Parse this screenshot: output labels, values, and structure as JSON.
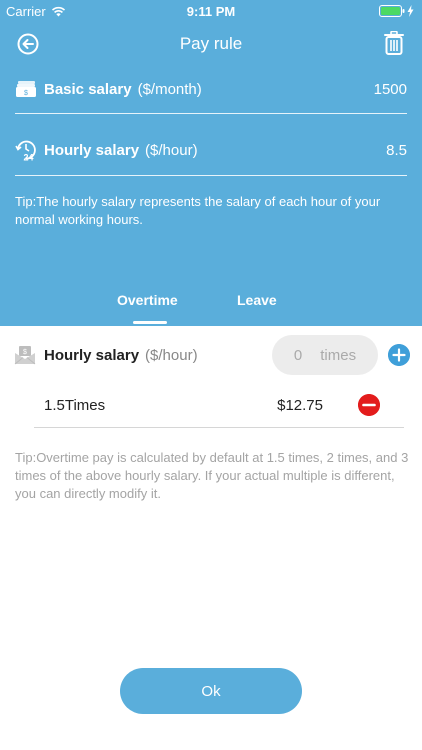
{
  "status": {
    "carrier": "Carrier",
    "time": "9:11 PM"
  },
  "nav": {
    "title": "Pay rule"
  },
  "basic": {
    "label": "Basic salary",
    "unit": "($/month)",
    "value": "1500"
  },
  "hourly": {
    "label": "Hourly salary",
    "unit": "($/hour)",
    "value": "8.5"
  },
  "tip_top": "Tip:The hourly salary represents the salary of each hour of your normal working hours.",
  "tabs": [
    {
      "label": "Overtime",
      "active": true
    },
    {
      "label": "Leave",
      "active": false
    }
  ],
  "overtime": {
    "label": "Hourly salary",
    "unit": "($/hour)",
    "input_value": "0",
    "input_unit": "times",
    "multiples": [
      {
        "label": "1.5Times",
        "amount": "$12.75"
      }
    ]
  },
  "tip_bottom": "Tip:Overtime pay is calculated by default at 1.5 times, 2 times, and 3 times of the above hourly salary. If your actual multiple is different, you can directly modify it.",
  "ok_label": "Ok",
  "colors": {
    "header": "#5aaedb",
    "plus": "#3f9fd9",
    "minus": "#e31c1c"
  }
}
